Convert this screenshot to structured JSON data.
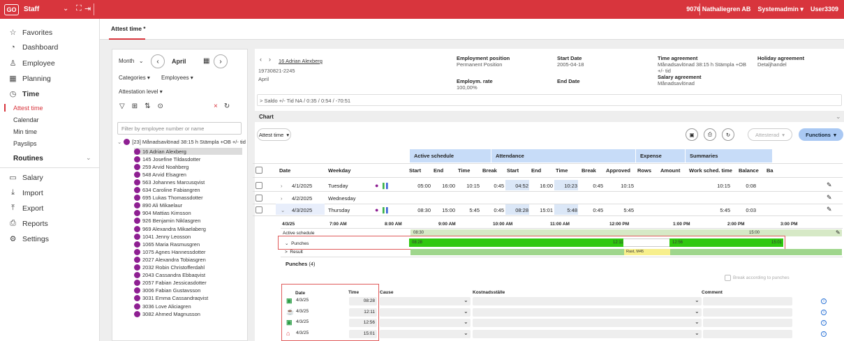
{
  "app": {
    "logo": "GO",
    "name": "Staff",
    "company": "9076 Nathaliegren AB",
    "role": "Systemadmin ▾",
    "user": "User3309"
  },
  "sidebar": {
    "favorites": "Favorites",
    "dashboard": "Dashboard",
    "employee": "Employee",
    "planning": "Planning",
    "time": "Time",
    "time_sub": [
      "Attest time",
      "Calendar",
      "Min time",
      "Payslips"
    ],
    "routines": "Routines",
    "salary": "Salary",
    "import": "Import",
    "export": "Export",
    "reports": "Reports",
    "settings": "Settings"
  },
  "tab": {
    "label": "Attest time *"
  },
  "left": {
    "period": "Month",
    "month": "April",
    "categories": "Categories",
    "employees": "Employees",
    "attestation": "Attestation level",
    "filter_placeholder": "Filter by employee number or name",
    "group": "[23]  Månadsavlönad 38:15 h Stämpla +OB +/- tid",
    "employees_list": [
      "16 Adrian Alexberg",
      "145 Josefine Tildasdotter",
      "259 Arvid Noahberg",
      "548 Arvid Elsagren",
      "563 Johannes Marcusqvist",
      "634 Caroline Fabiangren",
      "695 Lukas Thomassdotter",
      "890 Ali Mikaelaur",
      "904 Mattias Kimsson",
      "926 Benjamin Niklasgren",
      "969 Alexandra Mikaelaberg",
      "1041 Jenny Leosson",
      "1065 Maria Rasmusgren",
      "1075 Agnes Hannessdotter",
      "2027 Alexandra Tobiasgren",
      "2032 Robin Christofferdahl",
      "2043 Cassandra Ebbaqvist",
      "2057 Fabian Jessicasdotter",
      "3006 Fabian Gustavsson",
      "3031 Emma Cassandraqvist",
      "3036 Love Aliciagren",
      "3082 Ahmed Magnusson"
    ]
  },
  "header": {
    "employee_link": "16 Adrian Alexberg",
    "ssn": "19730821-2245",
    "month": "April",
    "employment_position_label": "Employment position",
    "employment_position": "Permanent Position",
    "employm_rate_label": "Employm. rate",
    "employm_rate": "100,00%",
    "start_date_label": "Start Date",
    "start_date": "2005-04-18",
    "end_date_label": "End Date",
    "time_agreement_label": "Time agreement",
    "time_agreement": "Månadsavlönad 38:15 h Stämpla +OB",
    "time_agreement_2": "+/- tid",
    "salary_agreement_label": "Salary agreement",
    "salary_agreement": "Månadsavlönad",
    "holiday_agreement_label": "Holiday agreement",
    "holiday_agreement": "Detaljhandel",
    "saldo": "Saldo +/- Tid  NA / 0:35 / 0:54 / -70:51"
  },
  "chart_label": "Chart",
  "toolbar": {
    "attest_time": "Attest time",
    "attesterad": "Attesterad",
    "functions": "Functions"
  },
  "groups": {
    "active_schedule": "Active schedule",
    "attendance": "Attendance",
    "expense": "Expense",
    "summaries": "Summaries"
  },
  "columns": [
    "Date",
    "Weekday",
    "Start",
    "End",
    "Time",
    "Break",
    "Start",
    "End",
    "Time",
    "Break",
    "Approved",
    "Rows",
    "Amount",
    "Work sched. time",
    "Balance",
    "Ba"
  ],
  "rows": [
    {
      "date": "4/1/2025",
      "weekday": "Tuesday",
      "s_start": "05:00",
      "s_end": "16:00",
      "s_time": "10:15",
      "s_break": "0:45",
      "a_start": "04:52",
      "a_end": "16:00",
      "a_time": "10:23",
      "a_break": "0:45",
      "approved": "10:15",
      "work": "10:15",
      "balance": "0:08"
    },
    {
      "date": "4/2/2025",
      "weekday": "Wednesday",
      "s_start": "",
      "s_end": "",
      "s_time": "",
      "s_break": "",
      "a_start": "",
      "a_end": "",
      "a_time": "",
      "a_break": "",
      "approved": "",
      "work": "",
      "balance": ""
    },
    {
      "date": "4/3/2025",
      "weekday": "Thursday",
      "s_start": "08:30",
      "s_end": "15:00",
      "s_time": "5:45",
      "s_break": "0:45",
      "a_start": "08:28",
      "a_end": "15:01",
      "a_time": "5:48",
      "a_break": "0:45",
      "approved": "5:45",
      "work": "5:45",
      "balance": "0:03"
    }
  ],
  "timeline": {
    "date": "4/3/25",
    "hours": [
      "7:00 AM",
      "8:00 AM",
      "9:00 AM",
      "10:00 AM",
      "11:00 AM",
      "12:00 PM",
      "1:00 PM",
      "2:00 PM",
      "3:00 PM"
    ],
    "active_schedule": "Active schedule",
    "punches": "Punches",
    "result": "Result",
    "sched_start": "08:30",
    "sched_end": "15:00",
    "punch_start": "08:28",
    "punch_break_start": "12:11",
    "punch_break_end": "12:56",
    "punch_end": "15:01",
    "rast": "Rast, M45"
  },
  "punches": {
    "title": "Punches",
    "count": "(4)",
    "break_label": "Break according to punches",
    "headers": {
      "date": "Date",
      "time": "Time",
      "cause": "Cause",
      "cost": "Kostnadsställe",
      "comment": "Comment"
    },
    "items": [
      {
        "date": "4/3/25",
        "time": "08:28",
        "icon": "door-in-icon"
      },
      {
        "date": "4/3/25",
        "time": "12:11",
        "icon": "coffee-icon"
      },
      {
        "date": "4/3/25",
        "time": "12:56",
        "icon": "door-in-icon"
      },
      {
        "date": "4/3/25",
        "time": "15:01",
        "icon": "home-icon"
      }
    ]
  }
}
